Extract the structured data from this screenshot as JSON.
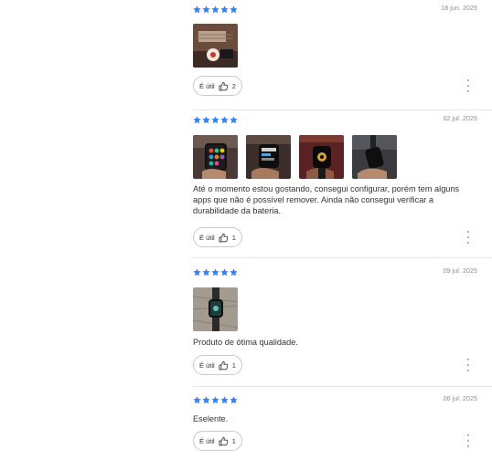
{
  "reviews": [
    {
      "rating": 5,
      "date": "18 jun. 2025",
      "photos": [
        "watch-photo"
      ],
      "text": "",
      "useful_label": "É útil",
      "useful_count": "2"
    },
    {
      "rating": 5,
      "date": "02 jul. 2025",
      "photos": [
        "watch-photo",
        "watch-photo",
        "watch-photo",
        "watch-photo"
      ],
      "text": "Até o momento estou gostando, consegui configurar, porém tem alguns apps que não é possível remover. Ainda não consegui verificar a durabilidade da bateria.",
      "useful_label": "É útil",
      "useful_count": "1"
    },
    {
      "rating": 5,
      "date": "09 jul. 2025",
      "photos": [
        "watch-photo"
      ],
      "text": "Produto de ótima qualidade.",
      "useful_label": "É útil",
      "useful_count": "1"
    },
    {
      "rating": 5,
      "date": "06 jul. 2025",
      "photos": [],
      "text": "Eselente.",
      "useful_label": "É útil",
      "useful_count": "1"
    }
  ],
  "colors": {
    "star": "#3483fa",
    "border": "#c9c9c9",
    "divider": "#e6e6e6"
  },
  "icons": {
    "star": "star-icon",
    "thumb": "thumbs-up-icon",
    "more": "kebab-menu-icon"
  }
}
